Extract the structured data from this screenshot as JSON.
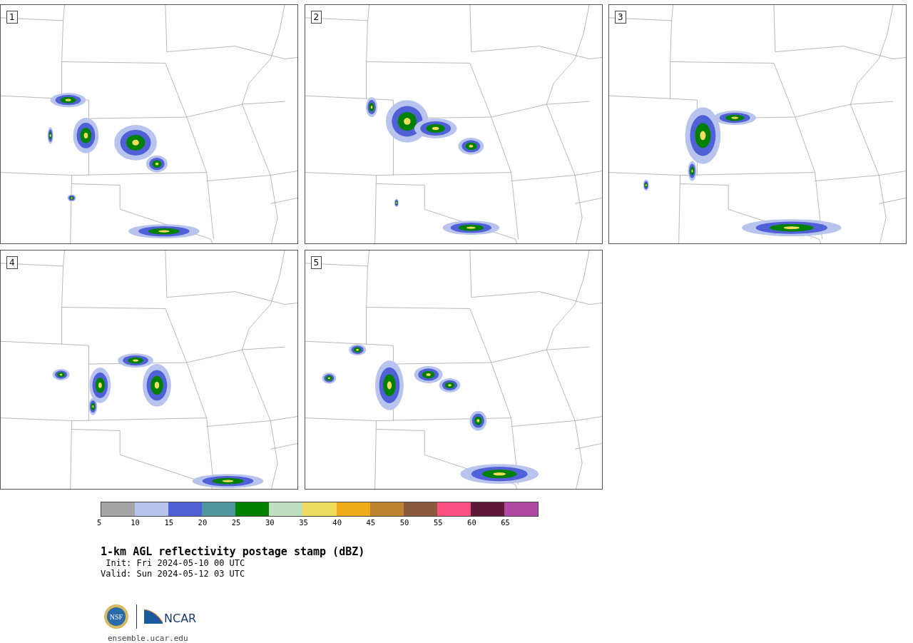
{
  "panels": [
    {
      "number": "1"
    },
    {
      "number": "2"
    },
    {
      "number": "3"
    },
    {
      "number": "4"
    },
    {
      "number": "5"
    }
  ],
  "colorbar": {
    "bins": [
      {
        "color": "#a6a6a6"
      },
      {
        "color": "#b8c4ee"
      },
      {
        "color": "#5060d6"
      },
      {
        "color": "#4f979c"
      },
      {
        "color": "#008000"
      },
      {
        "color": "#bfe0c0"
      },
      {
        "color": "#f0dc5c"
      },
      {
        "color": "#f0ac18"
      },
      {
        "color": "#bc8430"
      },
      {
        "color": "#8a5a3c"
      },
      {
        "color": "#f85080"
      },
      {
        "color": "#601838"
      },
      {
        "color": "#b048a4"
      }
    ],
    "ticks": [
      "5",
      "10",
      "15",
      "20",
      "25",
      "30",
      "35",
      "40",
      "45",
      "50",
      "55",
      "60",
      "65"
    ]
  },
  "title": "1-km AGL reflectivity postage stamp (dBZ)",
  "init": " Init: Fri 2024-05-10 00 UTC",
  "valid": "Valid: Sun 2024-05-12 03 UTC",
  "logo": {
    "seal_text": "NSF",
    "wordmark": "NCAR"
  },
  "site": "ensemble.ucar.edu"
}
